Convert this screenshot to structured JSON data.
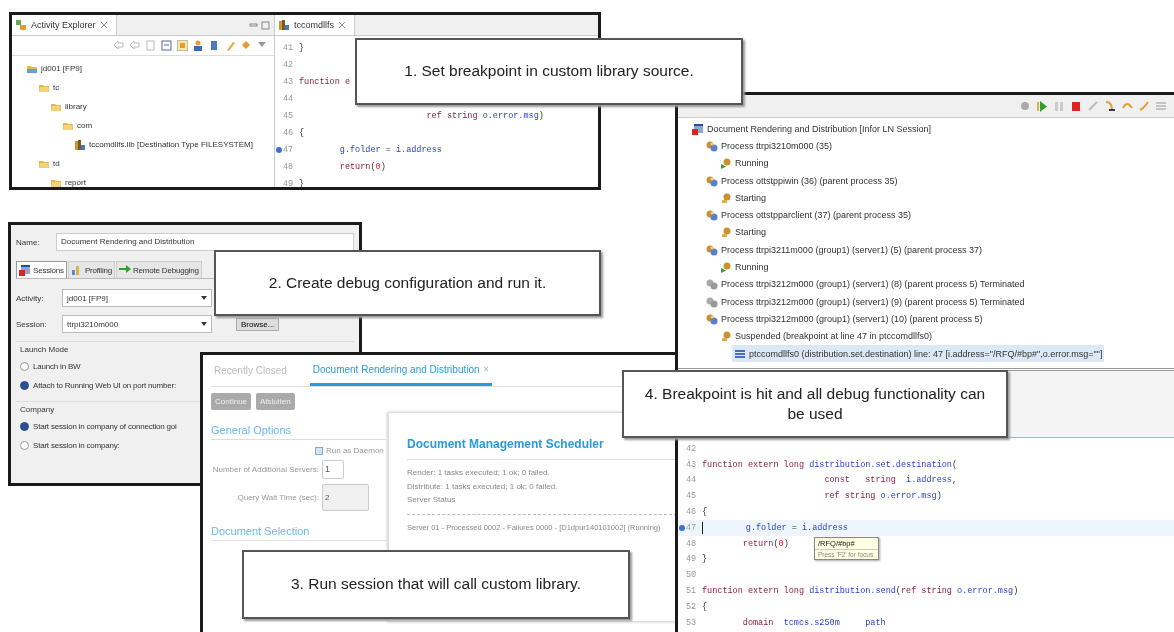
{
  "activity_explorer": {
    "title": "Activity Explorer",
    "tree": [
      {
        "label": "jd001 [FP9]",
        "kind": "project",
        "children": [
          {
            "label": "tc",
            "kind": "folder",
            "children": [
              {
                "label": "library",
                "kind": "folder",
                "children": [
                  {
                    "label": "com",
                    "kind": "folder",
                    "children": [
                      {
                        "label": "tccomdllfs.lib [Destination Type FILESYSTEM]",
                        "kind": "library"
                      }
                    ]
                  }
                ]
              }
            ]
          },
          {
            "label": "td",
            "kind": "folder",
            "children": [
              {
                "label": "report",
                "kind": "folder"
              }
            ]
          }
        ]
      }
    ]
  },
  "source_editor": {
    "tab": "tccomdllfs",
    "lines": [
      {
        "number": "41",
        "breakpoint": false,
        "tokens": [
          {
            "kind": "plain",
            "text": "}"
          }
        ]
      },
      {
        "number": "42",
        "breakpoint": false
      },
      {
        "number": "43",
        "breakpoint": false,
        "tokens": [
          {
            "kind": "keyword",
            "text": "function e"
          }
        ]
      },
      {
        "number": "44",
        "breakpoint": false
      },
      {
        "number": "45",
        "breakpoint": false,
        "tokens": [
          {
            "kind": "keyword",
            "text": "                         ref string "
          },
          {
            "kind": "ident",
            "text": "o.error.msg"
          },
          {
            "kind": "plain",
            "text": ")"
          }
        ]
      },
      {
        "number": "46",
        "breakpoint": false,
        "tokens": [
          {
            "kind": "plain",
            "text": "{"
          }
        ]
      },
      {
        "number": "47",
        "breakpoint": true,
        "tokens": [
          {
            "kind": "ident",
            "text": "        g.folder"
          },
          {
            "kind": "plain",
            "text": " = "
          },
          {
            "kind": "ident",
            "text": "i.address"
          }
        ]
      },
      {
        "number": "48",
        "breakpoint": false,
        "tokens": [
          {
            "kind": "keyword",
            "text": "        return"
          },
          {
            "kind": "plain",
            "text": "("
          },
          {
            "kind": "number",
            "text": "0"
          },
          {
            "kind": "plain",
            "text": ")"
          }
        ]
      },
      {
        "number": "49",
        "breakpoint": false,
        "tokens": [
          {
            "kind": "plain",
            "text": "}"
          }
        ]
      }
    ]
  },
  "launch_configuration": {
    "name_label": "Name:",
    "name_value": "Document Rendering and Distribution",
    "tabs": [
      {
        "label": "Sessions",
        "kind": "sessions",
        "selected": true
      },
      {
        "label": "Profiling",
        "kind": "profiling",
        "selected": false
      },
      {
        "label": "Remote Debugging",
        "kind": "remote",
        "selected": false
      }
    ],
    "activity_label": "Activity:",
    "activity_value": "jd001 [FP9]",
    "session_label": "Session:",
    "session_value": "ttrpi3210m000",
    "browse_button": "Browse...",
    "launch_mode": {
      "title": "Launch Mode",
      "options": [
        {
          "label": "Launch in BW",
          "selected": false
        },
        {
          "label": "Attach to Running Web UI on port number:",
          "selected": true
        }
      ]
    },
    "company": {
      "title": "Company",
      "options": [
        {
          "label": "Start session in company of connection goi",
          "selected": true
        },
        {
          "label": "Start session in company:",
          "selected": false
        }
      ]
    }
  },
  "debug_view": {
    "tree": [
      {
        "label": "Document Rendering and Distribution [Infor LN Session]",
        "kind": "session",
        "selected": false,
        "children": [
          {
            "label": "Process ttrpi3210m000 (35)",
            "kind": "process",
            "selected": false,
            "children": [
              {
                "label": "Running",
                "kind": "running",
                "selected": false
              }
            ]
          },
          {
            "label": "Process ottstppiwin (36) (parent process 35)",
            "kind": "process",
            "selected": false,
            "children": [
              {
                "label": "Starting",
                "kind": "starting",
                "selected": false
              }
            ]
          },
          {
            "label": "Process ottstpparclient (37) (parent process 35)",
            "kind": "process",
            "selected": false,
            "children": [
              {
                "label": "Starting",
                "kind": "starting",
                "selected": false
              }
            ]
          },
          {
            "label": "Process ttrpi3211m000 (group1) (server1)  (5) (parent process 37)",
            "kind": "process",
            "selected": false,
            "children": [
              {
                "label": "Running",
                "kind": "running",
                "selected": false
              }
            ]
          },
          {
            "label": "Process ttrpi3212m000 (group1) (server1)  (8) (parent process 5) Terminated",
            "kind": "terminated",
            "selected": false
          },
          {
            "label": "Process ttrpi3212m000 (group1) (server1)  (9) (parent process 5) Terminated",
            "kind": "terminated",
            "selected": false
          },
          {
            "label": "Process ttrpi3212m000 (group1) (server1)  (10) (parent process 5)",
            "kind": "process",
            "selected": false,
            "children": [
              {
                "label": "Suspended (breakpoint at line 47 in ptccomdllfs0)",
                "kind": "starting",
                "selected": false,
                "children": [
                  {
                    "label": "ptccomdllfs0 (distribution.set.destination) line: 47 [i.address=\"/RFQ/#bp#\",o.error.msg=\"\"]",
                    "kind": "frame",
                    "selected": true
                  }
                ]
              }
            ]
          }
        ]
      }
    ]
  },
  "debug_editor": {
    "lines": [
      {
        "number": "42",
        "breakpoint": false,
        "current": false
      },
      {
        "number": "43",
        "breakpoint": false,
        "current": false,
        "tokens": [
          {
            "kind": "keyword",
            "text": "function extern long "
          },
          {
            "kind": "ident",
            "text": "distribution.set.destination"
          },
          {
            "kind": "plain",
            "text": "("
          }
        ]
      },
      {
        "number": "44",
        "breakpoint": false,
        "current": false,
        "tokens": [
          {
            "kind": "keyword",
            "text": "                        const   string  "
          },
          {
            "kind": "ident",
            "text": "i.address"
          },
          {
            "kind": "plain",
            "text": ","
          }
        ]
      },
      {
        "number": "45",
        "breakpoint": false,
        "current": false,
        "tokens": [
          {
            "kind": "keyword",
            "text": "                        ref string "
          },
          {
            "kind": "ident",
            "text": "o.error.msg"
          },
          {
            "kind": "plain",
            "text": ")"
          }
        ]
      },
      {
        "number": "46",
        "breakpoint": false,
        "current": false,
        "tokens": [
          {
            "kind": "plain",
            "text": "{"
          }
        ]
      },
      {
        "number": "47",
        "breakpoint": true,
        "current": true,
        "tokens": [
          {
            "kind": "ident",
            "text": "        g.folder"
          },
          {
            "kind": "plain",
            "text": " = "
          },
          {
            "kind": "ident",
            "text": "i.address"
          }
        ]
      },
      {
        "number": "48",
        "breakpoint": false,
        "current": false,
        "tokens": [
          {
            "kind": "keyword",
            "text": "        return"
          },
          {
            "kind": "plain",
            "text": "("
          },
          {
            "kind": "number",
            "text": "0"
          },
          {
            "kind": "plain",
            "text": ")"
          }
        ]
      },
      {
        "number": "49",
        "breakpoint": false,
        "current": false,
        "tokens": [
          {
            "kind": "plain",
            "text": "}"
          }
        ]
      },
      {
        "number": "50",
        "breakpoint": false,
        "current": false
      },
      {
        "number": "51",
        "breakpoint": false,
        "current": false,
        "tokens": [
          {
            "kind": "keyword",
            "text": "function extern long "
          },
          {
            "kind": "ident",
            "text": "distribution.send"
          },
          {
            "kind": "plain",
            "text": "("
          },
          {
            "kind": "keyword",
            "text": "ref string "
          },
          {
            "kind": "ident",
            "text": "o.error.msg"
          },
          {
            "kind": "plain",
            "text": ")"
          }
        ]
      },
      {
        "number": "52",
        "breakpoint": false,
        "current": false,
        "tokens": [
          {
            "kind": "plain",
            "text": "{"
          }
        ]
      },
      {
        "number": "53",
        "breakpoint": false,
        "current": false,
        "tokens": [
          {
            "kind": "keyword",
            "text": "        domain  "
          },
          {
            "kind": "ident",
            "text": "tcmcs.s250m"
          },
          {
            "kind": "ident",
            "text": "     path"
          }
        ]
      }
    ],
    "tooltip": {
      "value": "/RFQ/#bp#",
      "hint": "Press 'F2' for focus."
    }
  },
  "web_session": {
    "tabs": [
      {
        "label": "Recently Closed",
        "selected": false,
        "closable": false
      },
      {
        "label": "Document Rendering and Distribution",
        "selected": true,
        "closable": true
      }
    ],
    "close_glyph": "×",
    "buttons": [
      {
        "label": "Continue",
        "disabled": true
      },
      {
        "label": "Afsluiten",
        "disabled": true
      }
    ],
    "general_options": "General Options",
    "daemon": {
      "label": "Run as Daemon",
      "checked": true
    },
    "fields": [
      {
        "label": "Number of Additional Servers:",
        "value": "1"
      },
      {
        "label": "Query Wait Time (sec):",
        "value": "2"
      }
    ],
    "document_selection": "Document Selection",
    "scheduler": {
      "title": "Document Management Scheduler",
      "lines": [
        "Render: 1 tasks executed; 1 ok; 0 failed.",
        "Distribute: 1 tasks executed; 1 ok; 0 failed.",
        "Server Status"
      ],
      "server": "Server 01 - Processed 0002 - Failures 0000 - [D1dpur140101002] (Running)"
    }
  },
  "callouts": [
    {
      "text": "1. Set breakpoint in custom library source."
    },
    {
      "text": "2. Create debug configuration and run it."
    },
    {
      "text": "3. Run session that will call custom library."
    },
    {
      "text": "4. Breakpoint is hit and all debug functionality can be used"
    }
  ]
}
